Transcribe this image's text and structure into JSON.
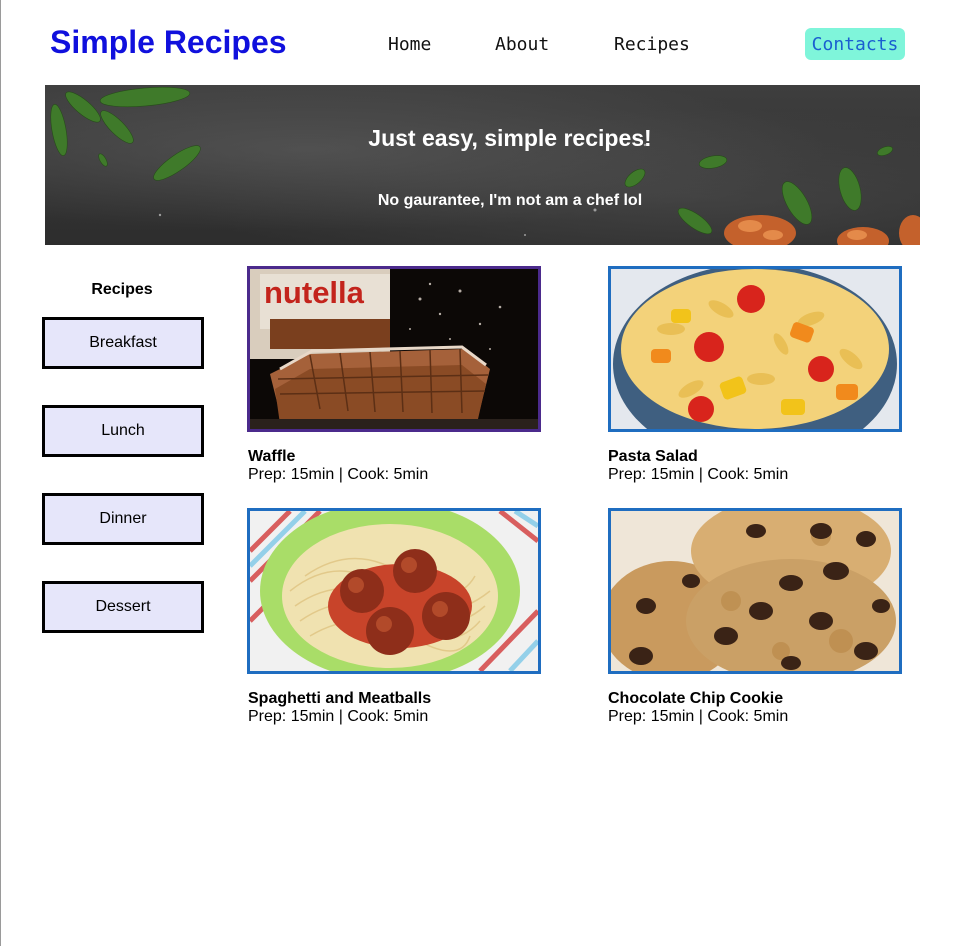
{
  "header": {
    "logo": "Simple Recipes",
    "nav": [
      "Home",
      "About",
      "Recipes"
    ],
    "contact": "Contacts"
  },
  "hero": {
    "title": "Just easy, simple recipes!",
    "subtitle": "No gaurantee, I'm not am a chef lol"
  },
  "sidebar": {
    "heading": "Recipes",
    "categories": [
      "Breakfast",
      "Lunch",
      "Dinner",
      "Dessert"
    ]
  },
  "recipes": [
    {
      "title": "Waffle",
      "meta": "Prep: 15min | Cook: 5min",
      "image": "waffle-photo",
      "jar_text": "nutella"
    },
    {
      "title": "Pasta Salad",
      "meta": "Prep: 15min | Cook: 5min",
      "image": "pasta-salad-photo"
    },
    {
      "title": "Spaghetti and Meatballs",
      "meta": "Prep: 15min | Cook: 5min",
      "image": "spaghetti-meatballs-photo"
    },
    {
      "title": "Chocolate Chip Cookie",
      "meta": "Prep: 15min | Cook: 5min",
      "image": "chocolate-chip-cookie-photo"
    }
  ],
  "colors": {
    "logo": "#1010dd",
    "contact_bg": "#7ff5da",
    "contact_text": "#1a5fd0",
    "category_bg": "#e6e6fa",
    "card_border": "#1f6dc0",
    "card_border_selected": "#4b2a8c"
  }
}
